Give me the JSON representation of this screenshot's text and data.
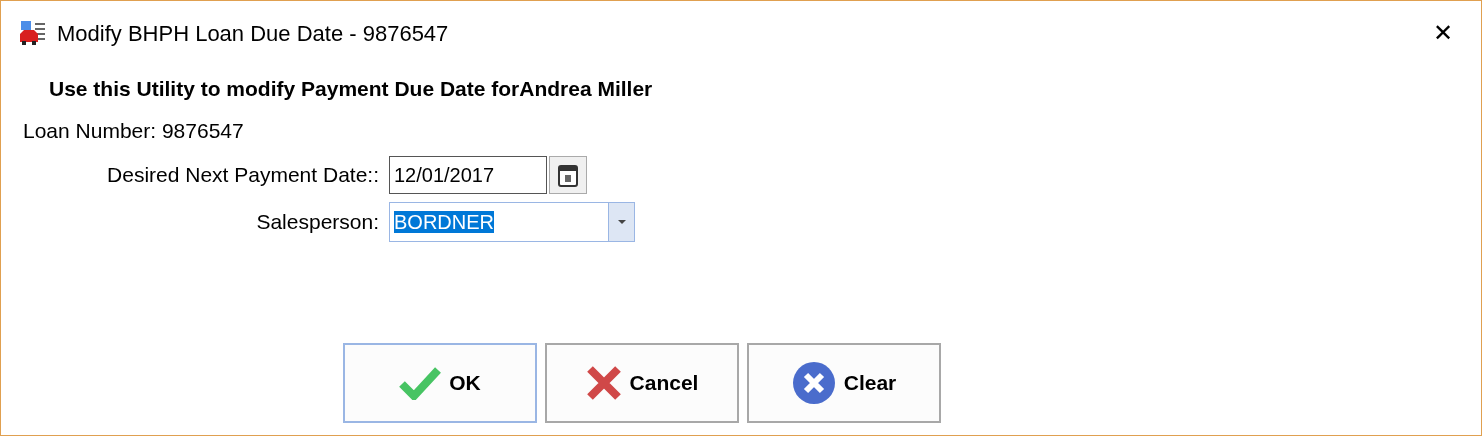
{
  "window": {
    "title": "Modify BHPH Loan Due Date - 9876547",
    "close": "✕"
  },
  "heading": "Use this Utility to modify Payment Due Date forAndrea Miller",
  "loan_number": "Loan Number: 9876547",
  "fields": [
    {
      "kind": "date",
      "label": "Desired Next Payment Date::",
      "value": "12/01/2017",
      "selected": false
    },
    {
      "kind": "dropdown",
      "label": "Salesperson:",
      "value": "BORDNER",
      "selected": true
    }
  ],
  "buttons": [
    {
      "kind": "ok",
      "label": "OK",
      "focused": true
    },
    {
      "kind": "cancel",
      "label": "Cancel",
      "focused": false
    },
    {
      "kind": "clear",
      "label": "Clear",
      "focused": false
    }
  ]
}
